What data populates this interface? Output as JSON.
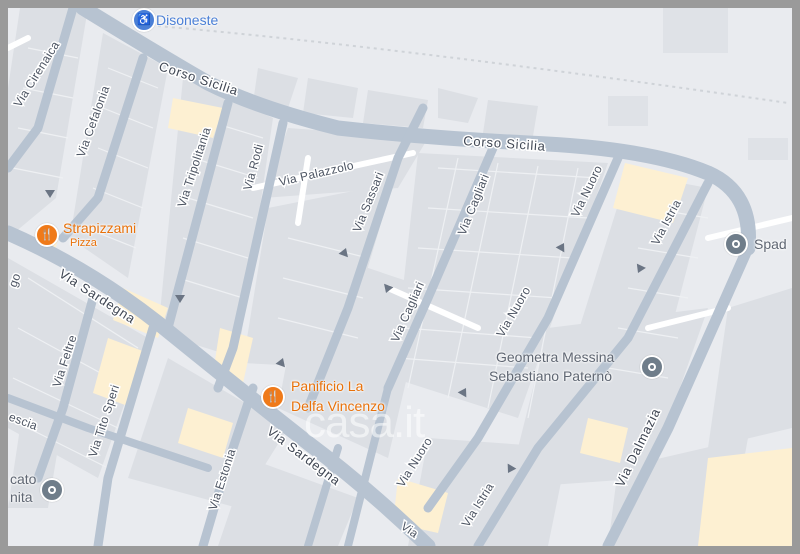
{
  "streets": {
    "corso_sicilia_1": "Corso Sicilia",
    "corso_sicilia_2": "Corso Sicilia",
    "via_cirenaica": "Via Cirenaica",
    "via_cefalonia": "Via Cefalonia",
    "via_tripolitania": "Via Tripolitania",
    "via_rodi": "Via Rodi",
    "via_palazzolo": "Via Palazzolo",
    "via_sassari": "Via Sassari",
    "via_cagliari_1": "Via Cagliari",
    "via_cagliari_2": "Via Cagliari",
    "via_nuoro_1": "Via Nuoro",
    "via_nuoro_2": "Via Nuoro",
    "via_nuoro_3": "Via Nuoro",
    "via_istria_1": "Via Istria",
    "via_istria_2": "Via Istria",
    "via_sardegna_1": "Via Sardegna",
    "via_sardegna_2": "Via Sardegna",
    "via_feltre": "Via Feltre",
    "via_tito_speri": "Via Tito Speri",
    "via_estonia": "Via Estonia",
    "via_dalmazia": "Via Dalmazia",
    "via_partial_bottom": "Via",
    "brescia_partial": "escia",
    "ago_partial": "go"
  },
  "pois": {
    "disoneste": "Disoneste",
    "strapizzami": "Strapizzami",
    "strapizzami_cat": "Pizza",
    "panificio_line1": "Panificio La",
    "panificio_line2": "Delfa Vincenzo",
    "geometra_line1": "Geometra Messina",
    "geometra_line2": "Sebastiano Paternò",
    "spad_partial": "Spad",
    "mercato_line1": "cato",
    "mercato_line2": "nita"
  },
  "watermark": "casa.it",
  "colors": {
    "road": "#b9c5d3",
    "block": "#d9dce2",
    "commercial": "#fdf0d4",
    "poi_orange": "#e8710a",
    "poi_gray": "#6f7d8a"
  }
}
